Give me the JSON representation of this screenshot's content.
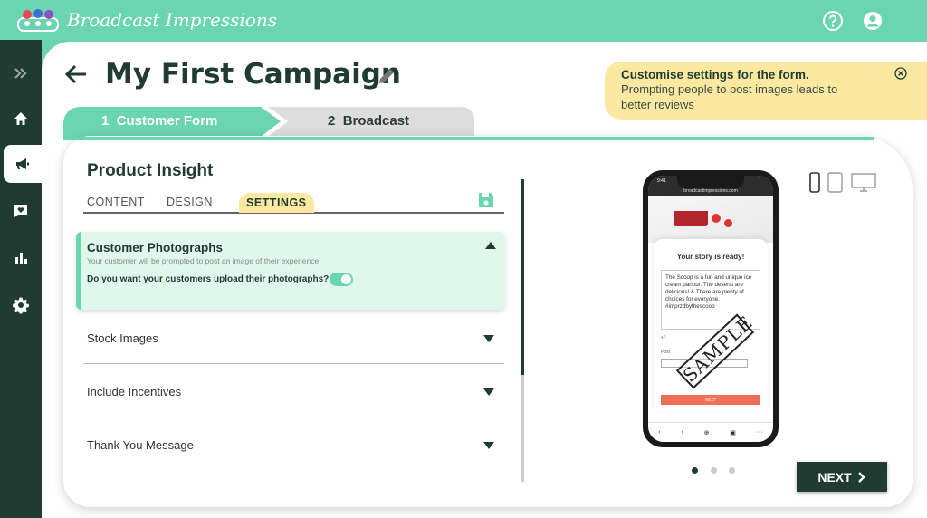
{
  "app": {
    "brand": "Broadcast Impressions"
  },
  "header": {
    "title": "My First Campaign"
  },
  "tip": {
    "title": "Customise settings for the form.",
    "text": "Prompting people to post images leads to better reviews"
  },
  "steps": [
    {
      "number": "1",
      "label": "Customer Form"
    },
    {
      "number": "2",
      "label": "Broadcast"
    }
  ],
  "form": {
    "title": "Product Insight",
    "tabs": [
      "CONTENT",
      "DESIGN",
      "SETTINGS"
    ],
    "active_tab": "SETTINGS",
    "open_panel": {
      "title": "Customer Photographs",
      "subtitle": "Your customer will be prompted to post an image of their experience",
      "question": "Do you want your customers upload their photographs?",
      "toggle_on": true
    },
    "accordions": [
      "Stock Images",
      "Include Incentives",
      "Thank You Message"
    ]
  },
  "preview": {
    "time": "9:41",
    "url": "broadcastimpressions.com",
    "story_title": "Your story is ready!",
    "story_text": "The Scoop is a fun and unique ice cream parlour. The deserts are delicious! & There are plenty of choices for everyone. #imprzdbythescoop",
    "post_label": "Post",
    "mini_next": "NEXT",
    "stamp": "SAMPLE"
  },
  "pager": {
    "count": 3,
    "active": 0
  },
  "next_label": "NEXT",
  "colors": {
    "accent": "#6bd5b1",
    "dark": "#1f3b32",
    "tip": "#fbe9a2",
    "cta": "#f27057"
  }
}
